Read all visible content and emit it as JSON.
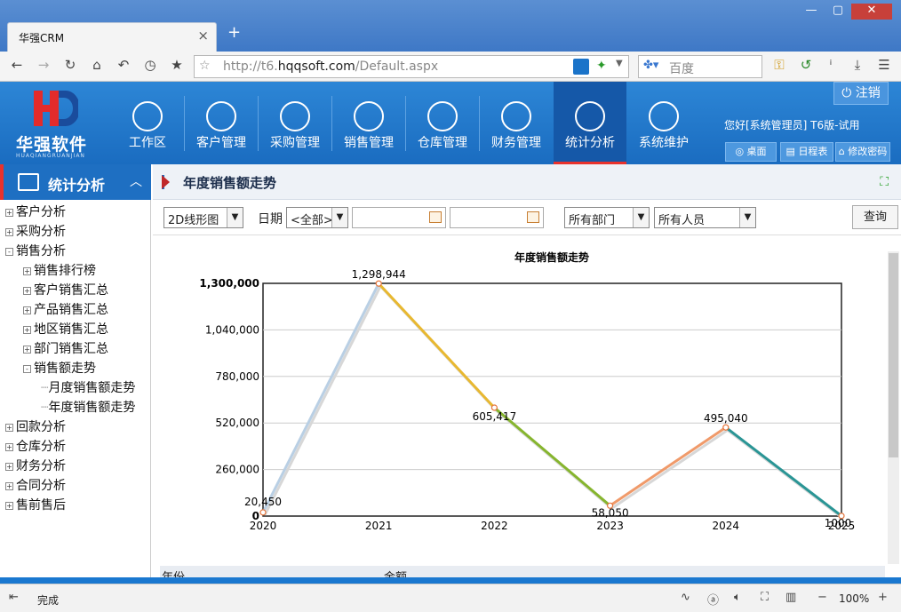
{
  "browser": {
    "tab_title": "华强CRM",
    "url_prefix": "http://t6.",
    "url_domain": "hqqsoft.com",
    "url_suffix": "/Default.aspx",
    "search_placeholder": "百度",
    "status": "完成",
    "zoom": "100%"
  },
  "app": {
    "logo_text": "华强软件",
    "logo_sub": "HUAQIANGRUANJIAN",
    "logout_label": "注销",
    "greeting": "您好[系统管理员] T6版-试用",
    "quick": [
      "桌面",
      "日程表",
      "修改密码"
    ],
    "menu": [
      {
        "label": "工作区"
      },
      {
        "label": "客户管理"
      },
      {
        "label": "采购管理"
      },
      {
        "label": "销售管理"
      },
      {
        "label": "仓库管理"
      },
      {
        "label": "财务管理"
      },
      {
        "label": "统计分析"
      },
      {
        "label": "系统维护"
      }
    ]
  },
  "sidebar": {
    "title": "统计分析",
    "items": [
      {
        "label": "客户分析",
        "level": 0,
        "sign": "+"
      },
      {
        "label": "采购分析",
        "level": 0,
        "sign": "+"
      },
      {
        "label": "销售分析",
        "level": 0,
        "sign": "-"
      },
      {
        "label": "销售排行榜",
        "level": 1,
        "sign": "+"
      },
      {
        "label": "客户销售汇总",
        "level": 1,
        "sign": "+"
      },
      {
        "label": "产品销售汇总",
        "level": 1,
        "sign": "+"
      },
      {
        "label": "地区销售汇总",
        "level": 1,
        "sign": "+"
      },
      {
        "label": "部门销售汇总",
        "level": 1,
        "sign": "+"
      },
      {
        "label": "销售额走势",
        "level": 1,
        "sign": "-"
      },
      {
        "label": "月度销售额走势",
        "level": 2,
        "sign": ""
      },
      {
        "label": "年度销售额走势",
        "level": 2,
        "sign": ""
      },
      {
        "label": "回款分析",
        "level": 0,
        "sign": "+"
      },
      {
        "label": "仓库分析",
        "level": 0,
        "sign": "+"
      },
      {
        "label": "财务分析",
        "level": 0,
        "sign": "+"
      },
      {
        "label": "合同分析",
        "level": 0,
        "sign": "+"
      },
      {
        "label": "售前售后",
        "level": 0,
        "sign": "+"
      }
    ]
  },
  "pane": {
    "title": "年度销售额走势",
    "filters": {
      "chart_type": "2D线形图",
      "date_label": "日期",
      "date_range": "<全部>",
      "department": "所有部门",
      "staff": "所有人员",
      "query_label": "查询"
    },
    "table_headers": [
      "年份",
      "金额"
    ]
  },
  "colors": {
    "header_blue": "#1a6cc0",
    "accent_red": "#e8322d"
  },
  "chart_data": {
    "type": "line",
    "title": "年度销售额走势",
    "x": [
      "2020",
      "2021",
      "2022",
      "2023",
      "2024",
      "2025"
    ],
    "values": [
      20450,
      1298944,
      605417,
      58050,
      495040,
      1000
    ],
    "value_labels": [
      "20,450",
      "1,298,944",
      "605,417",
      "58,050",
      "495,040",
      "1000"
    ],
    "yticks": [
      "0",
      "260,000",
      "520,000",
      "780,000",
      "1,040,000",
      "1,300,000"
    ],
    "ylim": [
      0,
      1300000
    ],
    "segment_colors": [
      "#b9cfe4",
      "#e8b830",
      "#86b52e",
      "#f09a6a",
      "#2a9595"
    ],
    "grid": true
  }
}
